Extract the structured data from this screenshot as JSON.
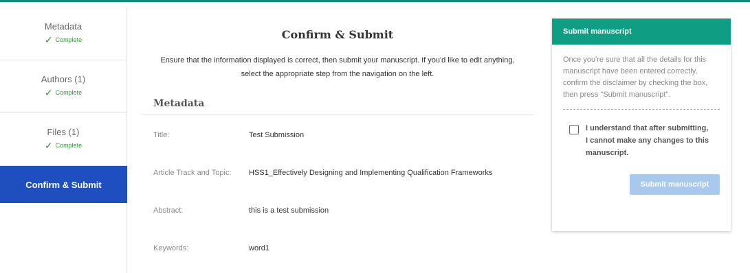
{
  "sidebar": {
    "steps": [
      {
        "label": "Metadata",
        "status": "Complete"
      },
      {
        "label": "Authors (1)",
        "status": "Complete"
      },
      {
        "label": "Files (1)",
        "status": "Complete"
      },
      {
        "label": "Confirm & Submit"
      }
    ]
  },
  "main": {
    "title": "Confirm & Submit",
    "intro": "Ensure that the information displayed is correct, then submit your manuscript. If you'd like to edit anything, select the appropriate step from the navigation on the left.",
    "section_title": "Metadata",
    "fields": [
      {
        "label": "Title:",
        "value": "Test Submission"
      },
      {
        "label": "Article Track and Topic:",
        "value": "HSS1_Effectively Designing and Implementing Qualification Frameworks"
      },
      {
        "label": "Abstract:",
        "value": "this is a test submission"
      },
      {
        "label": "Keywords:",
        "value": "word1"
      }
    ]
  },
  "panel": {
    "header": "Submit manuscript",
    "text": "Once you're sure that all the details for this manuscript have been entered correctly, confirm the disclaimer by checking the box, then press \"Submit manuscript\".",
    "confirm_label": "I understand that after submitting, I cannot make any changes to this manuscript.",
    "checkbox_checked": false,
    "button_label": "Submit manuscript",
    "button_enabled": false
  },
  "colors": {
    "accent": "#0f9d83",
    "active_step": "#1f4ebf",
    "complete": "#2e9a3c",
    "disabled_button": "#a9c8ee"
  }
}
